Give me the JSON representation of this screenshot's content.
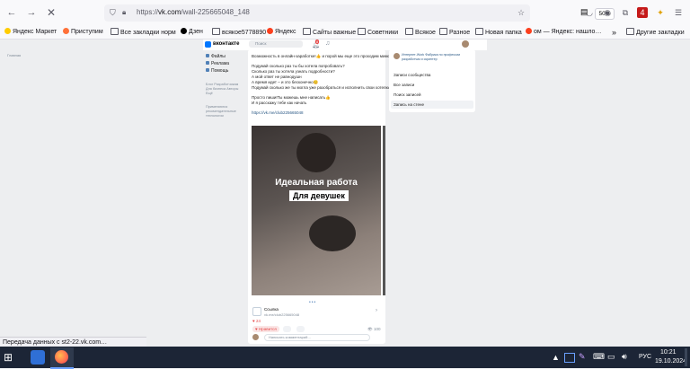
{
  "browser": {
    "url_prefix": "https://",
    "url_domain": "vk.com",
    "url_path": "/wall-225665048_148",
    "zoom": "50%",
    "downloads_badge": "4",
    "bookmarks": [
      {
        "label": "Яндекс Маркет",
        "icon": "yandex-market-icon",
        "color": "#ffcc00"
      },
      {
        "label": "Приступим",
        "icon": "firefox-icon",
        "color": "#ff7139"
      },
      {
        "label": "Все закладки норм",
        "icon": "folder-icon"
      },
      {
        "label": "Дзен",
        "icon": "dzen-icon",
        "color": "#000000"
      },
      {
        "label": "всякое5778890",
        "icon": "folder-icon"
      },
      {
        "label": "Яндекс",
        "icon": "yandex-icon",
        "color": "#fc3f1d"
      },
      {
        "label": "Сайты важные",
        "icon": "folder-icon"
      },
      {
        "label": "Советники",
        "icon": "folder-icon"
      },
      {
        "label": "Всякое",
        "icon": "folder-icon"
      },
      {
        "label": "Разное",
        "icon": "folder-icon"
      },
      {
        "label": "Новая папка",
        "icon": "folder-icon"
      },
      {
        "label": "ом — Яндекс: нашло…",
        "icon": "yandex-icon",
        "color": "#fc3f1d"
      }
    ],
    "bookmarks_overflow": "»",
    "other_bookmarks": "Другие закладки",
    "status_text": "Передача данных с st2-22.vk.com…"
  },
  "vk": {
    "logo": "вконтакте",
    "search_placeholder": "Поиск",
    "notif_badge": "8",
    "sidebar": [
      "Файлы",
      "Реклама",
      "Помощь"
    ],
    "footer_links": [
      "Блог",
      "Разработчикам",
      "Для бизнеса",
      "Авторы",
      "Ещё"
    ],
    "footer_note": "Применяются рекомендательные технологии",
    "post_text": [
      "Возможность в онлайн-заработке!👍 и порой мы еще это проходим мимо",
      "Подумай сколько раз ты бы хотела попробовать?",
      "Сколько раз ты хотела узнать подробности?",
      "А мой ответ не равнодушн",
      "А время идет – и это бесконечно😊",
      "Подумай сколько же ты могла уже разобраться и исполнить свои хотелки",
      "Просто пиши!Ты можешь мне написать👍",
      "И я расскажу тебе как начать"
    ],
    "post_link": "https://vk.me/club225665048",
    "image_title": "Идеальная работа",
    "image_subtitle": "Для девушек",
    "attachment_title": "Ссылка",
    "attachment_url": "vk.me/club225665048",
    "likes_count": "24",
    "like_button": "Нравится",
    "views": "100",
    "comment_placeholder": "Написать комментарий…",
    "right_panel": {
      "group_name": "Интернет-Work Фабрика по профессии разработчик и скриптер",
      "items": [
        "Записи сообщества",
        "Все записи",
        "Поиск записей",
        "Запись на стене"
      ]
    },
    "left_sidebar_label": "Главная"
  },
  "taskbar": {
    "lang": "РУС",
    "time": "10:21",
    "date": "19.10.2024"
  }
}
